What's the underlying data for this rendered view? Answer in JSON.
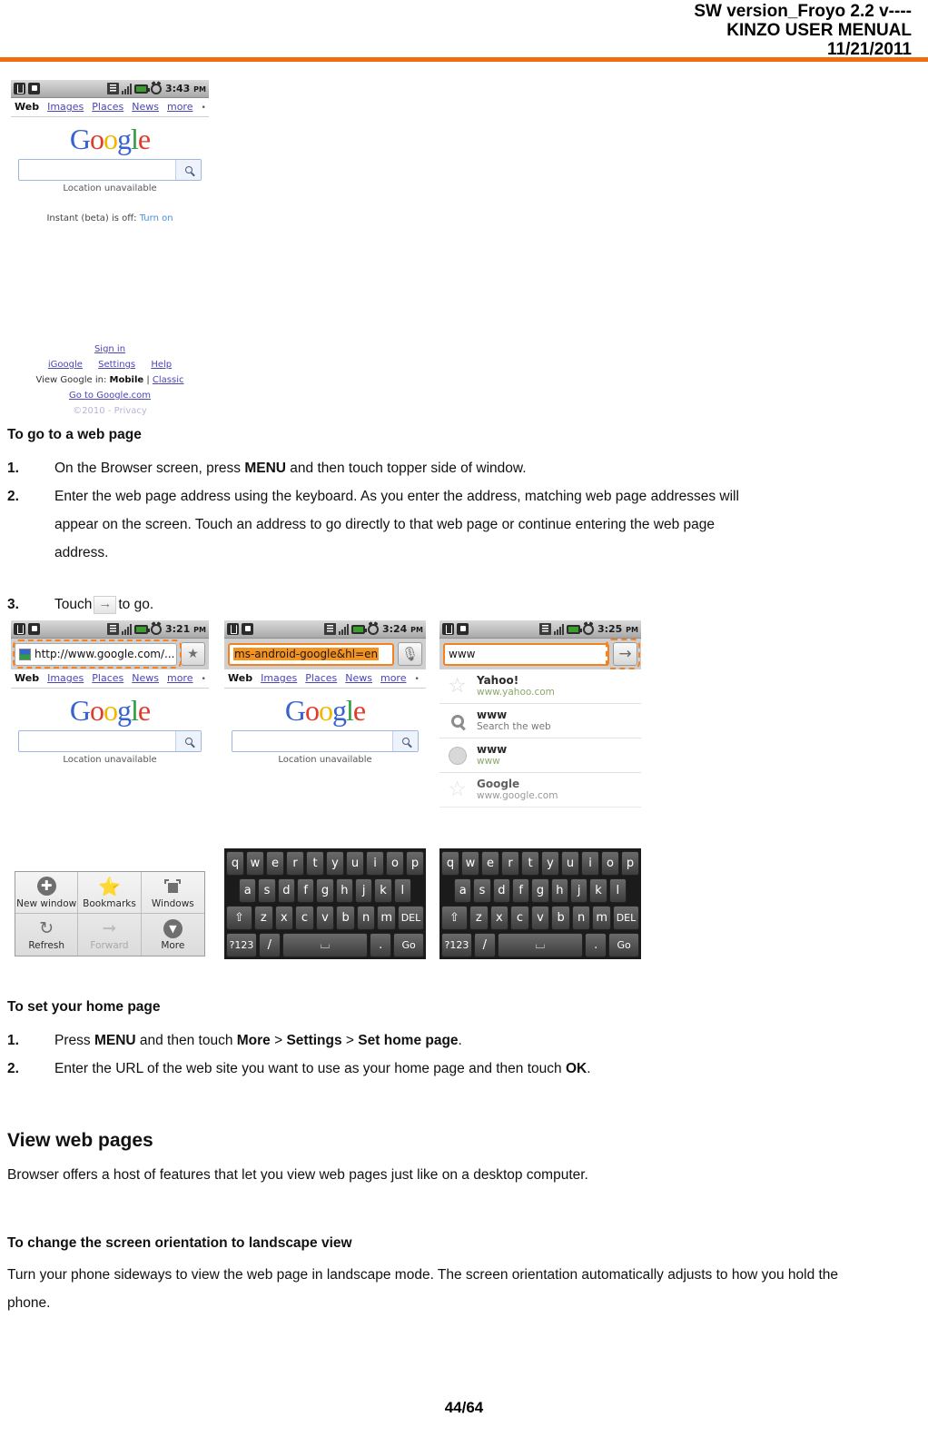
{
  "header": {
    "line1": "SW version_Froyo 2.2 v----",
    "line2": "KINZO USER MENUAL",
    "line3": "11/21/2011",
    "rule_color": "#F26B0C"
  },
  "footer": {
    "page": "44/64"
  },
  "shots": {
    "shot1": {
      "status": {
        "time": "3:43",
        "ampm": "PM"
      },
      "nav": {
        "current": "Web",
        "links": [
          "Images",
          "Places",
          "News",
          "more"
        ],
        "dot": "•"
      },
      "logo": "Google",
      "location_text": "Location unavailable",
      "instant_label": "Instant (beta) is off:",
      "instant_link": "Turn on",
      "footer": {
        "signin": "Sign in",
        "links": [
          "iGoogle",
          "Settings",
          "Help"
        ],
        "view_label": "View Google in:",
        "view_current": "Mobile",
        "view_sep": "|",
        "view_alt": "Classic",
        "goto": "Go to Google.com",
        "copyright": "©2010 - Privacy"
      }
    },
    "shot2": {
      "status": {
        "time": "3:21",
        "ampm": "PM"
      },
      "url_value": "http://www.google.com/...",
      "bookmark_icon": "bookmark-icon",
      "nav": {
        "current": "Web",
        "links": [
          "Images",
          "Places",
          "News",
          "more"
        ],
        "dot": "•"
      },
      "logo": "Google",
      "location_text": "Location unavailable",
      "menu": [
        {
          "label": "New window",
          "icon": "plus-circle-icon",
          "disabled": false
        },
        {
          "label": "Bookmarks",
          "icon": "bookmark-star-icon",
          "disabled": false
        },
        {
          "label": "Windows",
          "icon": "windows-icon",
          "disabled": false
        },
        {
          "label": "Refresh",
          "icon": "refresh-icon",
          "disabled": false
        },
        {
          "label": "Forward",
          "icon": "forward-arrow-icon",
          "disabled": true
        },
        {
          "label": "More",
          "icon": "more-chevron-icon",
          "disabled": false
        }
      ]
    },
    "shot3": {
      "status": {
        "time": "3:24",
        "ampm": "PM"
      },
      "url_value": "ms-android-google&hl=en",
      "mic_icon": "microphone-icon",
      "nav": {
        "current": "Web",
        "links": [
          "Images",
          "Places",
          "News",
          "more"
        ],
        "dot": "•"
      },
      "logo": "Google",
      "location_text": "Location unavailable"
    },
    "shot4": {
      "status": {
        "time": "3:25",
        "ampm": "PM"
      },
      "url_value": "www",
      "go_icon": "arrow-right-icon",
      "suggestions": [
        {
          "title": "Yahoo!",
          "sub": "www.yahoo.com",
          "icon": "star-icon",
          "sub_style": "green"
        },
        {
          "title": "www",
          "sub": "Search the web",
          "icon": "search-icon",
          "sub_style": "gray"
        },
        {
          "title": "www",
          "sub": "www",
          "icon": "globe-icon",
          "sub_style": "green"
        },
        {
          "title": "Google",
          "sub": "www.google.com",
          "icon": "star-icon",
          "sub_style": "gray"
        }
      ]
    },
    "keyboard": {
      "row1": [
        "q",
        "w",
        "e",
        "r",
        "t",
        "y",
        "u",
        "i",
        "o",
        "p"
      ],
      "row2": [
        "a",
        "s",
        "d",
        "f",
        "g",
        "h",
        "j",
        "k",
        "l"
      ],
      "row3_shift": "⇧",
      "row3": [
        "z",
        "x",
        "c",
        "v",
        "b",
        "n",
        "m"
      ],
      "row3_del": "DEL",
      "row4_sym": "?123",
      "row4_slash": "/",
      "row4_space": "⌴",
      "row4_dot": ".",
      "row4_go": "Go"
    }
  },
  "content": {
    "sec1_title": "To go to a web page",
    "sec1_steps": [
      {
        "num": "1.",
        "pre": "On the Browser screen, press ",
        "bold": "MENU",
        "post": " and then touch topper side of window."
      },
      {
        "num": "2.",
        "pre": "Enter the web page address using the keyboard. As you enter the address, matching web page addresses will appear on the screen. Touch an address to go directly to that web page or continue entering the web page address.",
        "bold": "",
        "post": ""
      }
    ],
    "step3_num": "3.",
    "step3_pre": "Touch",
    "step3_post": "to go.",
    "sec2_title": "To set your home page",
    "sec2_step1": {
      "num": "1.",
      "a": "Press ",
      "b1": "MENU",
      "c": " and then touch ",
      "b2": "More",
      "d": " > ",
      "b3": "Settings",
      "e": " > ",
      "b4": "Set home page",
      "f": "."
    },
    "sec2_step2": {
      "num": "2.",
      "a": "Enter the URL of the web site you want to use as your home page and then touch ",
      "b1": "OK",
      "f": "."
    },
    "sec3_title": "View web pages",
    "sec3_body": "Browser offers a host of features that let you view web pages just like on a desktop computer.",
    "sec4_title": "To change the screen orientation to landscape view",
    "sec4_body": "Turn your phone sideways to view the web page in landscape mode. The screen orientation automatically adjusts to how you hold the phone."
  }
}
